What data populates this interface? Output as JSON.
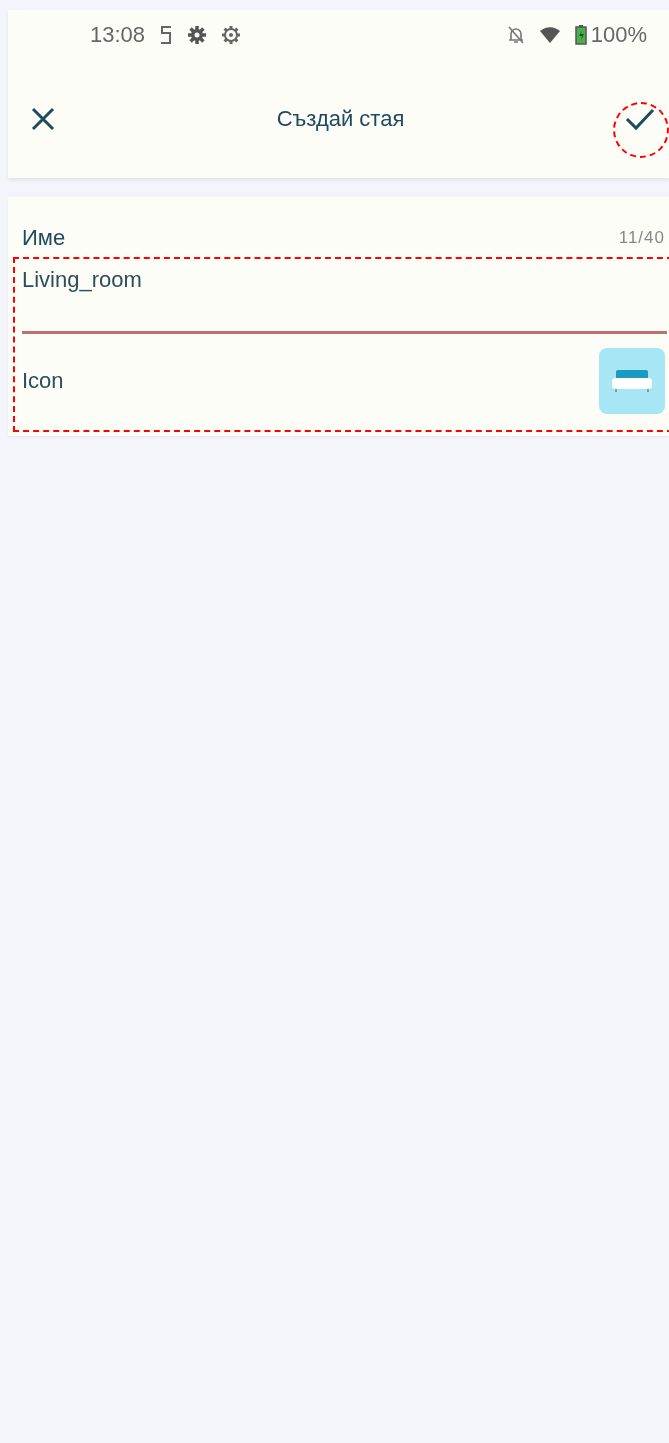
{
  "status_bar": {
    "time": "13:08",
    "battery": "100%"
  },
  "header": {
    "title": "Създай стая"
  },
  "form": {
    "name_label": "Име",
    "counter": "11/40",
    "name_value": "Living_room",
    "icon_label": "Icon"
  }
}
